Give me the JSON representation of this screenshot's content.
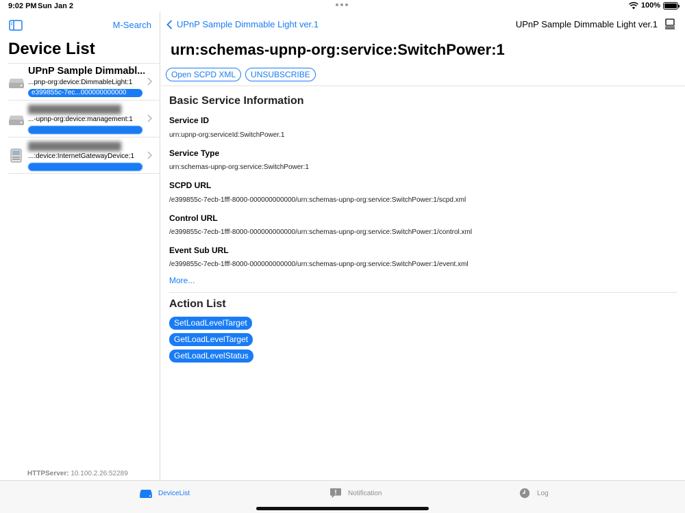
{
  "status_bar": {
    "time": "9:02 PM",
    "date": "Sun Jan 2",
    "battery": "100%"
  },
  "sidebar": {
    "search_label": "M-Search",
    "title": "Device List",
    "devices": [
      {
        "name": "UPnP Sample Dimmabl...",
        "type": "...pnp-org:device:DimmableLight:1",
        "uuid": "e399855c-7ec...000000000000"
      },
      {
        "name": "",
        "type": "...-upnp-org:device:management:1",
        "uuid": ""
      },
      {
        "name": "",
        "type": "...:device:InternetGatewayDevice:1",
        "uuid": ""
      }
    ],
    "http_server_label": "HTTPServer:",
    "http_server_value": "10.100.2.26:52289"
  },
  "nav": {
    "back_label": "UPnP Sample Dimmable Light ver.1",
    "right_title": "UPnP Sample Dimmable Light ver.1"
  },
  "service": {
    "title": "urn:schemas-upnp-org:service:SwitchPower:1",
    "buttons": {
      "open_scpd": "Open SCPD XML",
      "unsubscribe": "UNSUBSCRIBE"
    },
    "basic_info_heading": "Basic Service Information",
    "fields": [
      {
        "label": "Service ID",
        "value": "urn:upnp-org:serviceId:SwitchPower.1"
      },
      {
        "label": "Service Type",
        "value": "urn:schemas-upnp-org:service:SwitchPower:1"
      },
      {
        "label": "SCPD URL",
        "value": "/e399855c-7ecb-1fff-8000-000000000000/urn:schemas-upnp-org:service:SwitchPower:1/scpd.xml"
      },
      {
        "label": "Control URL",
        "value": "/e399855c-7ecb-1fff-8000-000000000000/urn:schemas-upnp-org:service:SwitchPower:1/control.xml"
      },
      {
        "label": "Event Sub URL",
        "value": "/e399855c-7ecb-1fff-8000-000000000000/urn:schemas-upnp-org:service:SwitchPower:1/event.xml"
      }
    ],
    "more_label": "More...",
    "action_list_heading": "Action List",
    "actions": [
      "SetLoadLevelTarget",
      "GetLoadLevelTarget",
      "GetLoadLevelStatus"
    ]
  },
  "tabbar": {
    "tabs": [
      {
        "label": "DeviceList",
        "icon": "device-list-icon",
        "active": true
      },
      {
        "label": "Notification",
        "icon": "notification-icon",
        "active": false
      },
      {
        "label": "Log",
        "icon": "clock-icon",
        "active": false
      }
    ]
  },
  "colors": {
    "accent": "#1a7cf5",
    "inactive": "#8e8e8e"
  }
}
